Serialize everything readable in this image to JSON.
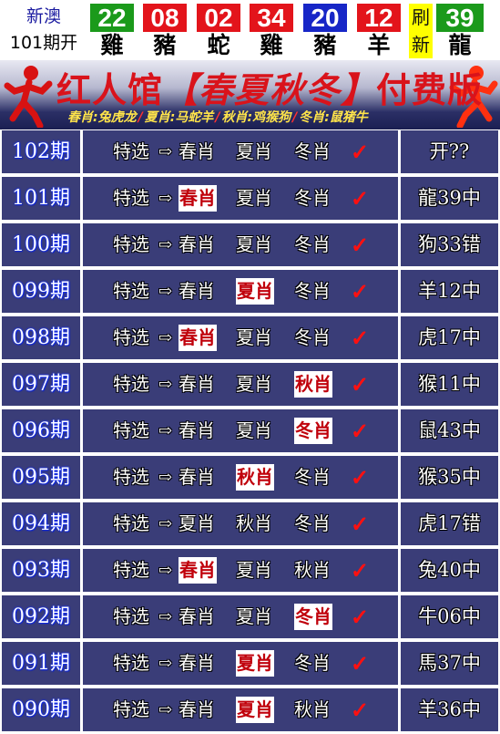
{
  "header": {
    "region": "新澳",
    "issue": "101期开",
    "balls": [
      {
        "number": "22",
        "zodiac": "雞",
        "color": "#1b9a1b"
      },
      {
        "number": "08",
        "zodiac": "豬",
        "color": "#e3141b"
      },
      {
        "number": "02",
        "zodiac": "蛇",
        "color": "#e3141b"
      },
      {
        "number": "34",
        "zodiac": "雞",
        "color": "#e3141b"
      },
      {
        "number": "20",
        "zodiac": "豬",
        "color": "#1726c7"
      },
      {
        "number": "12",
        "zodiac": "羊",
        "color": "#e3141b"
      }
    ],
    "refresh": {
      "line1": "刷",
      "line2": "新"
    },
    "special": {
      "number": "39",
      "zodiac": "龍",
      "color": "#1b9a1b"
    }
  },
  "banner": {
    "title_a": "红人馆",
    "title_b": "【春夏秋冬】",
    "title_c": "付费版",
    "seasons": [
      "春肖:兔虎龙",
      "夏肖:马蛇羊",
      "秋肖:鸡猴狗",
      "冬肖:鼠猪牛"
    ],
    "sep": "/"
  },
  "rows": [
    {
      "period": "102期",
      "label": "特选",
      "arrow": "⇨",
      "s1": "春肖",
      "s2": "夏肖",
      "s3": "冬肖",
      "hit": 0,
      "check": "✓",
      "result": "开??"
    },
    {
      "period": "101期",
      "label": "特选",
      "arrow": "⇨",
      "s1": "春肖",
      "s2": "夏肖",
      "s3": "冬肖",
      "hit": 1,
      "check": "✓",
      "result": "龍39中"
    },
    {
      "period": "100期",
      "label": "特选",
      "arrow": "⇨",
      "s1": "春肖",
      "s2": "夏肖",
      "s3": "冬肖",
      "hit": 0,
      "check": "✓",
      "result": "狗33错"
    },
    {
      "period": "099期",
      "label": "特选",
      "arrow": "⇨",
      "s1": "春肖",
      "s2": "夏肖",
      "s3": "冬肖",
      "hit": 2,
      "check": "✓",
      "result": "羊12中"
    },
    {
      "period": "098期",
      "label": "特选",
      "arrow": "⇨",
      "s1": "春肖",
      "s2": "夏肖",
      "s3": "冬肖",
      "hit": 1,
      "check": "✓",
      "result": "虎17中"
    },
    {
      "period": "097期",
      "label": "特选",
      "arrow": "⇨",
      "s1": "春肖",
      "s2": "夏肖",
      "s3": "秋肖",
      "hit": 3,
      "check": "✓",
      "result": "猴11中"
    },
    {
      "period": "096期",
      "label": "特选",
      "arrow": "⇨",
      "s1": "春肖",
      "s2": "夏肖",
      "s3": "冬肖",
      "hit": 3,
      "check": "✓",
      "result": "鼠43中"
    },
    {
      "period": "095期",
      "label": "特选",
      "arrow": "⇨",
      "s1": "春肖",
      "s2": "秋肖",
      "s3": "冬肖",
      "hit": 2,
      "check": "✓",
      "result": "猴35中"
    },
    {
      "period": "094期",
      "label": "特选",
      "arrow": "⇨",
      "s1": "夏肖",
      "s2": "秋肖",
      "s3": "冬肖",
      "hit": 0,
      "check": "✓",
      "result": "虎17错"
    },
    {
      "period": "093期",
      "label": "特选",
      "arrow": "⇨",
      "s1": "春肖",
      "s2": "夏肖",
      "s3": "秋肖",
      "hit": 1,
      "check": "✓",
      "result": "兔40中"
    },
    {
      "period": "092期",
      "label": "特选",
      "arrow": "⇨",
      "s1": "春肖",
      "s2": "夏肖",
      "s3": "冬肖",
      "hit": 3,
      "check": "✓",
      "result": "牛06中"
    },
    {
      "period": "091期",
      "label": "特选",
      "arrow": "⇨",
      "s1": "春肖",
      "s2": "夏肖",
      "s3": "冬肖",
      "hit": 2,
      "check": "✓",
      "result": "馬37中"
    },
    {
      "period": "090期",
      "label": "特选",
      "arrow": "⇨",
      "s1": "春肖",
      "s2": "夏肖",
      "s3": "秋肖",
      "hit": 2,
      "check": "✓",
      "result": "羊36中"
    }
  ]
}
